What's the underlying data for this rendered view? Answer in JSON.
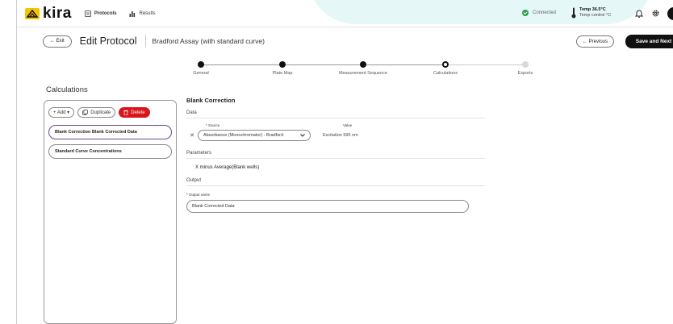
{
  "app": {
    "logo_text": "kira",
    "nav": [
      {
        "label": "Protocols",
        "icon": "protocol-icon",
        "active": true
      },
      {
        "label": "Results",
        "icon": "bar-chart-icon",
        "active": false
      }
    ],
    "status": {
      "text": "Connected",
      "color": "#2e9e4e"
    },
    "temperature": {
      "value": "Temp 36.5°C",
      "sub": "Temp control °C"
    },
    "icons": [
      "bell-icon",
      "gear-icon",
      "avatar"
    ]
  },
  "header": {
    "exit_label": "← Exit",
    "title": "Edit Protocol",
    "protocol_name": "Bradford Assay (with standard curve)",
    "previous_label": "← Previous",
    "next_label": "Save and Next"
  },
  "steps": [
    {
      "label": "General",
      "state": "done"
    },
    {
      "label": "Plate Map",
      "state": "done"
    },
    {
      "label": "Measurement Sequence",
      "state": "done"
    },
    {
      "label": "Calculations",
      "state": "current"
    },
    {
      "label": "Exports",
      "state": "todo"
    }
  ],
  "calculations": {
    "title": "Calculations",
    "toolbar": {
      "add_label": "+ Add ▾",
      "duplicate_label": "Duplicate",
      "delete_label": "Delete"
    },
    "items": [
      {
        "label": "Blank Correction Blank Corrected Data",
        "selected": true
      },
      {
        "label": "Standard Curve Concentrations",
        "selected": false
      }
    ]
  },
  "detail": {
    "title": "Blank Correction",
    "data_label": "Data",
    "source_header": "* Source",
    "value_header": "Value",
    "remove_symbol": "✕",
    "source_value": "Absorbance (Monochromator) - Bradford",
    "value": "Excitation 595 nm",
    "parameters_label": "Parameters",
    "formula": "X minus Average(Blank wells)",
    "output_label": "Output",
    "output_name_label": "* Output name",
    "output_name_value": "Blank Corrected Data"
  },
  "colors": {
    "accent": "#111111",
    "delete": "#d9141b",
    "selected_border": "#6a4c8c"
  }
}
